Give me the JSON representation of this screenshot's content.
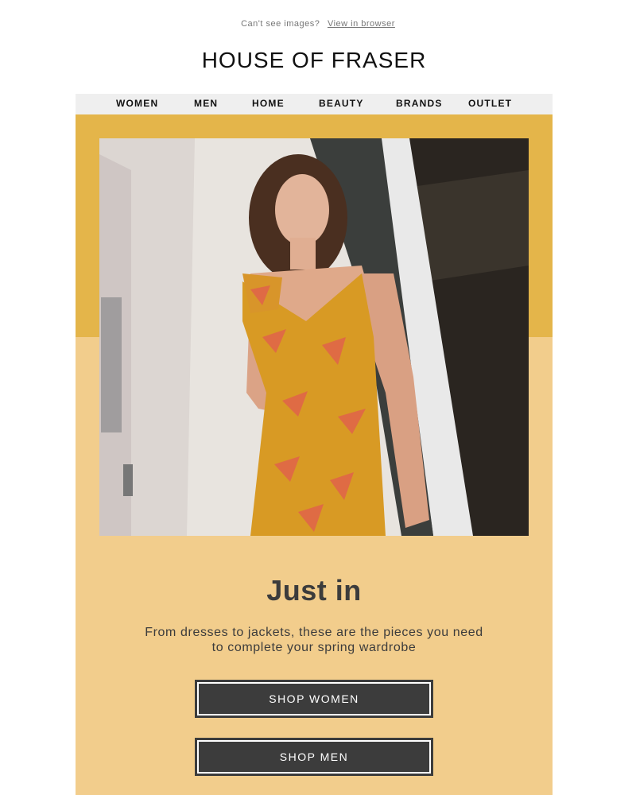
{
  "preheader": {
    "text": "Can't see images?",
    "link": "View in browser"
  },
  "brand": {
    "logo_text": "HOUSE OF FRASER"
  },
  "nav": {
    "items": [
      "WOMEN",
      "MEN",
      "HOME",
      "BEAUTY",
      "BRANDS",
      "OUTLET"
    ]
  },
  "hero": {
    "image_icon": "hero-photo-icon"
  },
  "content": {
    "headline": "Just in",
    "subcopy_line1": "From dresses to jackets, these are the pieces you need",
    "subcopy_line2": "to complete your spring wardrobe"
  },
  "buttons": {
    "shop_women": "SHOP WOMEN",
    "shop_men": "SHOP MEN"
  },
  "colors": {
    "band_top": "#e4b54a",
    "band_bottom": "#f2cd8c",
    "button": "#3c3c3c",
    "nav_bg": "#efefef"
  }
}
